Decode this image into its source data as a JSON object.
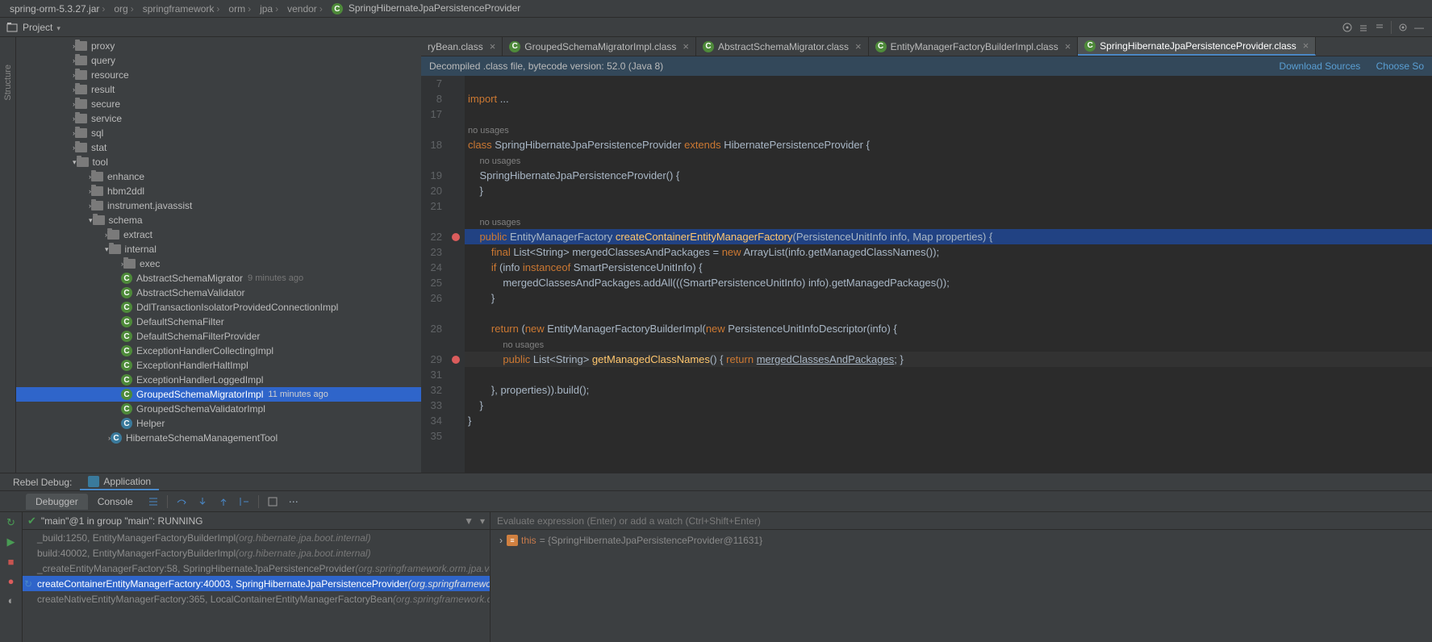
{
  "breadcrumbs": {
    "jar": "spring-orm-5.3.27.jar",
    "p1": "org",
    "p2": "springframework",
    "p3": "orm",
    "p4": "jpa",
    "p5": "vendor",
    "cls": "SpringHibernateJpaPersistenceProvider"
  },
  "project_label": "Project",
  "tree": {
    "proxy": "proxy",
    "query": "query",
    "resource": "resource",
    "result": "result",
    "secure": "secure",
    "service": "service",
    "sql": "sql",
    "stat": "stat",
    "tool": "tool",
    "enhance": "enhance",
    "hbm2ddl": "hbm2ddl",
    "instrument": "instrument.javassist",
    "schema": "schema",
    "extract": "extract",
    "internal": "internal",
    "exec": "exec",
    "c_abstract_migrator": "AbstractSchemaMigrator",
    "c_abstract_migrator_ts": "9 minutes ago",
    "c_abstract_validator": "AbstractSchemaValidator",
    "c_ddl": "DdlTransactionIsolatorProvidedConnectionImpl",
    "c_defaultfilter": "DefaultSchemaFilter",
    "c_defaultfilterprov": "DefaultSchemaFilterProvider",
    "c_excoll": "ExceptionHandlerCollectingImpl",
    "c_exhalt": "ExceptionHandlerHaltImpl",
    "c_exlog": "ExceptionHandlerLoggedImpl",
    "c_grpmig": "GroupedSchemaMigratorImpl",
    "c_grpmig_ts": "11 minutes ago",
    "c_grpval": "GroupedSchemaValidatorImpl",
    "c_helper": "Helper",
    "c_hibmgmt": "HibernateSchemaManagementTool"
  },
  "tabs": {
    "t0": "ryBean.class",
    "t1": "GroupedSchemaMigratorImpl.class",
    "t2": "AbstractSchemaMigrator.class",
    "t3": "EntityManagerFactoryBuilderImpl.class",
    "t4": "SpringHibernateJpaPersistenceProvider.class"
  },
  "banner": {
    "text": "Decompiled .class file, bytecode version: 52.0 (Java 8)",
    "dl": "Download Sources",
    "choose": "Choose So"
  },
  "lines": {
    "l7": "7",
    "l8": "8",
    "l17": "17",
    "l18": "18",
    "l19": "19",
    "l20": "20",
    "l21": "21",
    "l22": "22",
    "l23": "23",
    "l24": "24",
    "l25": "25",
    "l26": "26",
    "l28": "28",
    "l29": "29",
    "l31": "31",
    "l32": "32",
    "l33": "33",
    "l34": "34",
    "l35": "35"
  },
  "code": {
    "import_kw": "import",
    "import_rest": " ...",
    "nu": "no usages",
    "class_kw": "class ",
    "class_nm": "SpringHibernateJpaPersistenceProvider ",
    "extends_kw": "extends ",
    "super_nm": "HibernatePersistenceProvider ",
    "ob": "{",
    "ctor": "    SpringHibernateJpaPersistenceProvider() {",
    "cbrace": "    }",
    "pub_kw": "    public ",
    "ret_ty": "EntityManagerFactory ",
    "m_nm": "createContainerEntityManagerFactory",
    "m_sig": "(PersistenceUnitInfo info, Map properties) {",
    "final_kw": "        final ",
    "l23_rest": "List<String> mergedClassesAndPackages = ",
    "new_kw": "new ",
    "l23_tail": "ArrayList(info.getManagedClassNames());",
    "if_kw": "        if ",
    "l24_a": "(info ",
    "inst_kw": "instanceof ",
    "l24_b": "SmartPersistenceUnitInfo) {",
    "l25": "            mergedClassesAndPackages.addAll(((SmartPersistenceUnitInfo) info).getManagedPackages());",
    "l26": "        }",
    "ret_kw2": "        return ",
    "l28_a": "(",
    "new_kw2": "new ",
    "l28_b": "EntityManagerFactoryBuilderImpl(",
    "new_kw3": "new ",
    "l28_c": "PersistenceUnitInfoDescriptor(info) {",
    "l29_indent": "            ",
    "l29_pub": "public ",
    "l29_ret": "List<String> ",
    "l29_nm": "getManagedClassNames",
    "l29_sig": "() { ",
    "l29_ret_kw": "return ",
    "l29_var": "mergedClassesAndPackages",
    "l29_tail": "; }",
    "l32": "        }, properties)).build();",
    "l33": "    }",
    "l34": "}"
  },
  "debug": {
    "rebel_tab": "Rebel Debug:",
    "app_tab": "Application",
    "debugger": "Debugger",
    "console": "Console",
    "thread": "\"main\"@1 in group \"main\": RUNNING",
    "f0": "_build:1250, EntityManagerFactoryBuilderImpl ",
    "f0p": "(org.hibernate.jpa.boot.internal)",
    "f1": "build:40002, EntityManagerFactoryBuilderImpl ",
    "f1p": "(org.hibernate.jpa.boot.internal)",
    "f2": "_createEntityManagerFactory:58, SpringHibernateJpaPersistenceProvider ",
    "f2p": "(org.springframework.orm.jpa.vend",
    "f3": "createContainerEntityManagerFactory:40003, SpringHibernateJpaPersistenceProvider ",
    "f3p": "(org.springframework.o",
    "f4": "createNativeEntityManagerFactory:365, LocalContainerEntityManagerFactoryBean ",
    "f4p": "(org.springframework.orm",
    "eval_ph": "Evaluate expression (Enter) or add a watch (Ctrl+Shift+Enter)",
    "var_this": "this",
    "var_this_val": " = {SpringHibernateJpaPersistenceProvider@11631}"
  }
}
